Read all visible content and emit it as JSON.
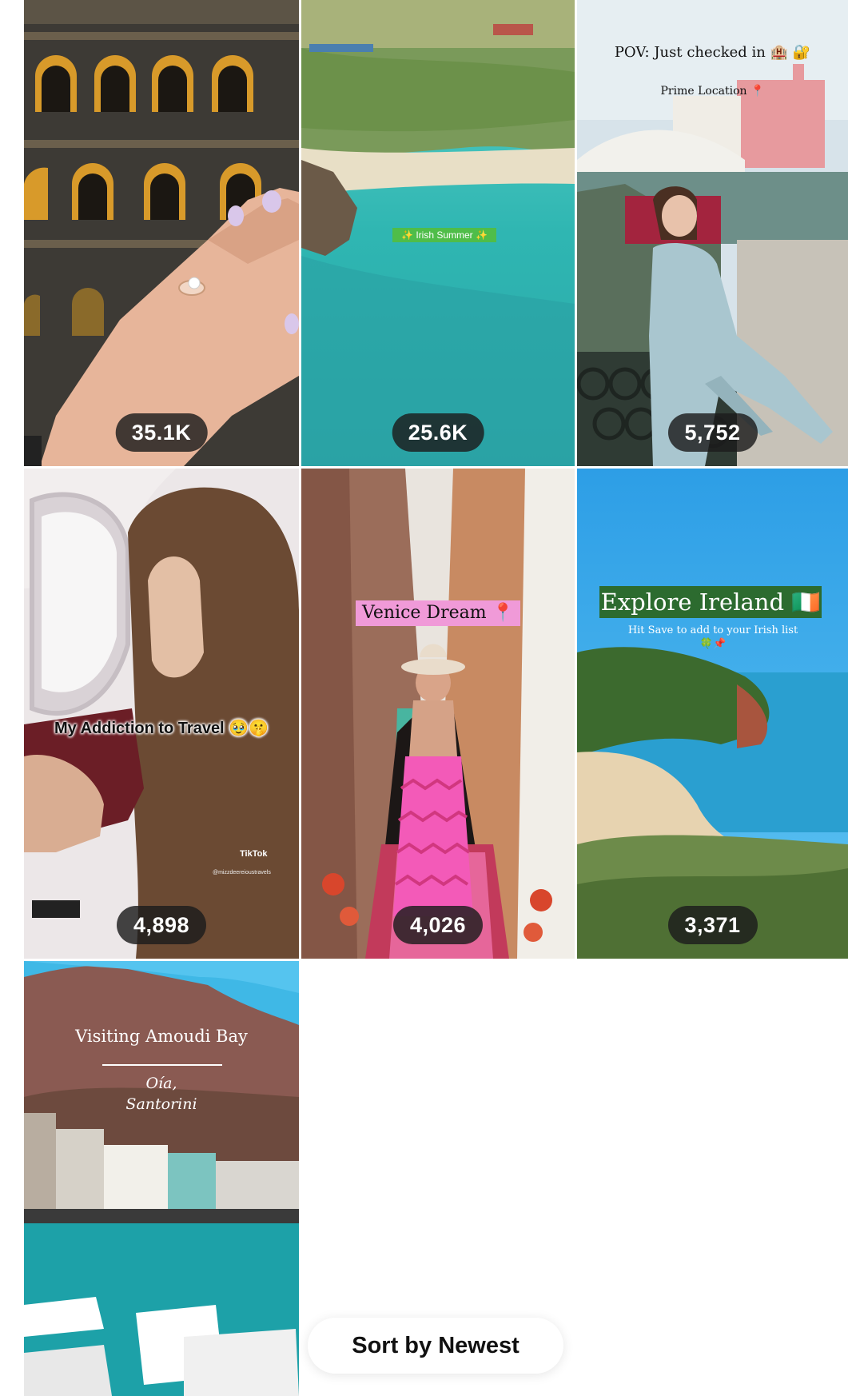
{
  "videos": [
    {
      "views": "35.1K",
      "scene": "ring-hand-at-colosseum"
    },
    {
      "views": "25.6K",
      "scene": "irish-beach-aerial",
      "captions": {
        "overlay": "✨ Irish Summer ✨"
      }
    },
    {
      "views": "5,752",
      "scene": "venice-rialto-balcony",
      "captions": {
        "headline": "POV: Just checked in 🏨 🔐",
        "sub": "Prime Location 📍"
      }
    },
    {
      "views": "4,898",
      "scene": "airplane-window-passport",
      "captions": {
        "headline": "My Addiction to Travel 🥹🤫",
        "watermark": "TikTok",
        "handle": "@mizzdeereioustravels"
      }
    },
    {
      "views": "4,026",
      "scene": "venice-gondola-canal",
      "captions": {
        "headline": "Venice Dream 📍"
      }
    },
    {
      "views": "3,371",
      "scene": "ireland-coast-beach",
      "captions": {
        "headline": "Explore Ireland 🇮🇪",
        "sub": "Hit Save to add to your Irish list 🍀📌"
      }
    },
    {
      "views": "",
      "scene": "santorini-amoudi-bay",
      "captions": {
        "headline": "Visiting Amoudi Bay",
        "place1": "Oía,",
        "place2": "Santorini"
      }
    }
  ],
  "sort": {
    "label": "Sort by Newest"
  }
}
